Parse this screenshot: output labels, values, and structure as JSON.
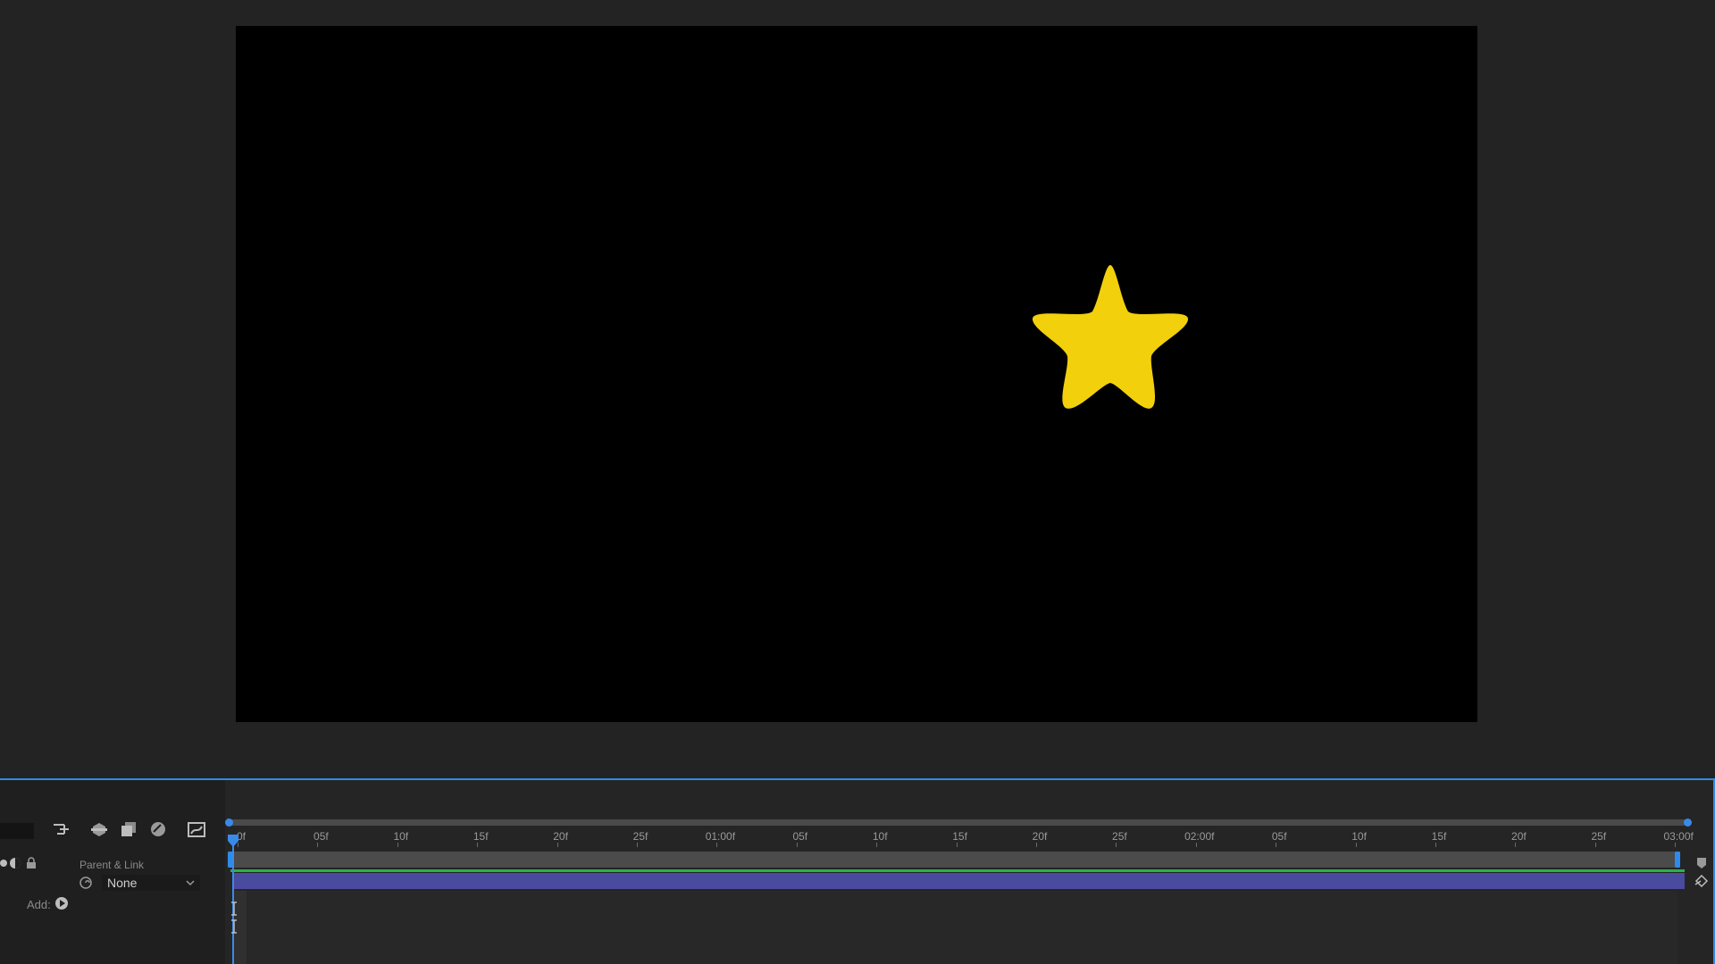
{
  "viewer": {
    "canvas_color": "#000000",
    "star": {
      "color": "#f2d00c",
      "icon": "star-shape"
    }
  },
  "toolbar": {
    "icons": [
      "comp-flowchart-icon",
      "draft-3d-icon",
      "frame-blending-icon",
      "motion-blur-icon",
      "graph-editor-icon"
    ]
  },
  "layer": {
    "parent_link_label": "Parent & Link",
    "parent_value": "None",
    "add_label": "Add:"
  },
  "ruler": {
    "ticks": [
      "0f",
      "05f",
      "10f",
      "15f",
      "20f",
      "25f",
      "01:00f",
      "05f",
      "10f",
      "15f",
      "20f",
      "25f",
      "02:00f",
      "05f",
      "10f",
      "15f",
      "20f",
      "25f",
      "03:00f"
    ]
  },
  "colors": {
    "accent": "#2d8ceb",
    "layer_bar": "#4a4a9e",
    "green_line": "#29b34a"
  }
}
